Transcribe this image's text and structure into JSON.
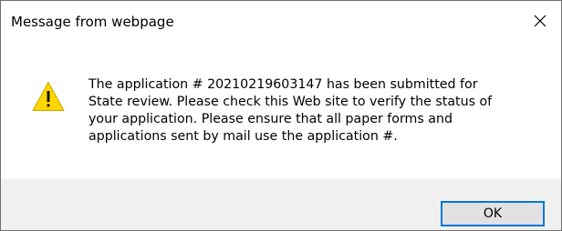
{
  "dialog": {
    "title": "Message from webpage",
    "close_icon": "close-icon",
    "icon": "warning-icon",
    "message": "The application # 20210219603147 has been submitted for\nState review. Please check this Web site to verify the status of\nyour application. Please ensure that all paper forms and\napplications sent by mail use the application #.",
    "ok_label": "OK"
  },
  "colors": {
    "footer_bg": "#f0f0f0",
    "button_border": "#0078d7",
    "button_bg": "#e1e1e1",
    "warning_fill": "#ffd700"
  }
}
